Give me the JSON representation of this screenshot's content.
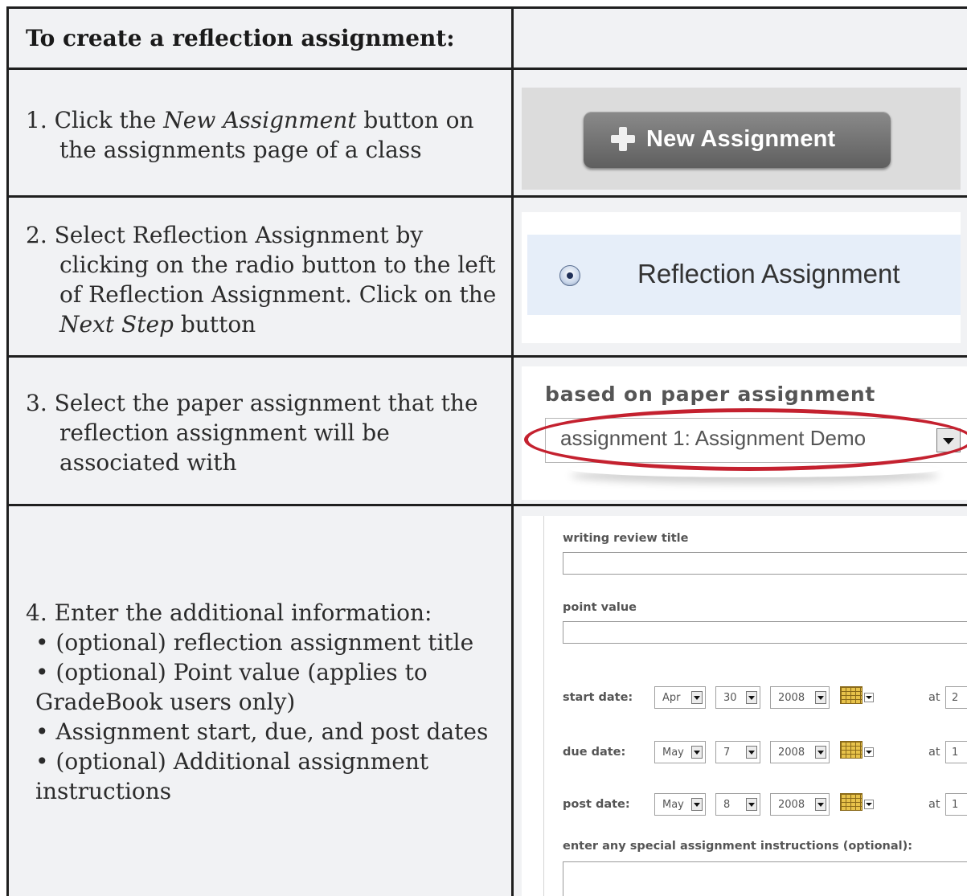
{
  "header": {
    "title": "To create a reflection assignment:"
  },
  "steps": [
    {
      "num": "1.",
      "pre": "Click the ",
      "em": "New Assignment",
      "post": " button on the assignments page of a class"
    },
    {
      "num": "2.",
      "pre": "Select Reflection Assignment by clicking on the radio button to the left of Reflection Assignment. Click on the ",
      "em": "Next Step",
      "post": " button"
    },
    {
      "num": "3.",
      "text": "Select the paper assignment that the reflection assignment will be associated with"
    },
    {
      "num": "4.",
      "intro": "Enter the additional information:",
      "bullets": [
        "• (optional) reflection assignment title",
        "• (optional) Point value (applies to GradeBook users only)",
        "• Assignment start, due, and post dates",
        "• (optional) Additional assignment instructions"
      ]
    }
  ],
  "shot1": {
    "button_label": "New Assignment",
    "icon": "plus-icon"
  },
  "shot2": {
    "radio_label": "Reflection Assignment"
  },
  "shot3": {
    "label": "based on paper assignment",
    "selected": "assignment 1: Assignment Demo"
  },
  "shot4": {
    "title_label": "writing review title",
    "points_label": "point value",
    "dates": [
      {
        "label": "start date:",
        "month": "Apr",
        "day": "30",
        "year": "2008",
        "at": "at",
        "time": "2"
      },
      {
        "label": "due date:",
        "month": "May",
        "day": "7",
        "year": "2008",
        "at": "at",
        "time": "1"
      },
      {
        "label": "post date:",
        "month": "May",
        "day": "8",
        "year": "2008",
        "at": "at",
        "time": "1"
      }
    ],
    "instructions_label": "enter any special assignment instructions (optional):"
  },
  "colors": {
    "border": "#1f1f1f",
    "cell_bg": "#f1f2f4",
    "highlight": "#c4212f",
    "radio_band": "#e6eef9"
  }
}
